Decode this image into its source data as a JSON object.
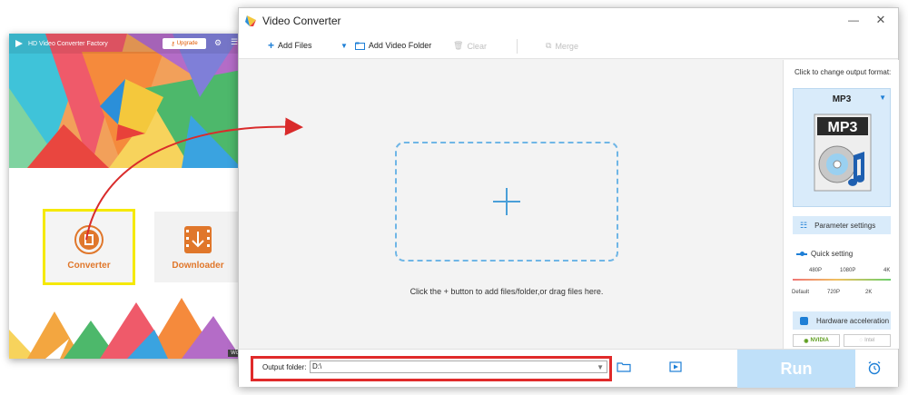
{
  "launcher": {
    "title": "HD Video Converter Factory",
    "upgrade_label": "Upgrade",
    "tiles": [
      {
        "label": "Converter"
      },
      {
        "label": "Downloader"
      }
    ],
    "badge": "Wo"
  },
  "converter": {
    "title": "Video Converter",
    "toolbar": {
      "add_files": "Add Files",
      "add_folder": "Add Video Folder",
      "clear": "Clear",
      "merge": "Merge"
    },
    "drop_hint": "Click the + button to add files/folder,or drag files here.",
    "side": {
      "caption": "Click to change output format:",
      "format_name": "MP3",
      "format_icon_text": "MP3",
      "parameter_settings": "Parameter settings",
      "quick_setting": "Quick setting",
      "quality_top": [
        "480P",
        "1080P",
        "4K"
      ],
      "quality_bottom": [
        "Default",
        "720P",
        "2K"
      ],
      "hardware_acceleration": "Hardware acceleration",
      "gpu_nvidia": "NVIDIA",
      "gpu_intel": "Intel"
    },
    "output_folder_label": "Output folder:",
    "output_folder_value": "D:\\",
    "run_label": "Run"
  },
  "colors": {
    "accent": "#1e7fd6",
    "highlight_yellow": "#f5e900",
    "highlight_red": "#e02a2a",
    "run_bg": "#bfe0f9",
    "tile_text": "#e0772b"
  },
  "icons": [
    "app-logo-icon",
    "gear-icon",
    "menu-icon",
    "converter-icon",
    "download-icon",
    "plus-icon",
    "chevron-down-icon",
    "folder-icon",
    "trash-icon",
    "merge-icon",
    "mp3-file-icon",
    "sliders-icon",
    "chip-icon",
    "open-folder-icon",
    "preview-icon",
    "alarm-icon",
    "minimize-icon",
    "close-icon"
  ]
}
